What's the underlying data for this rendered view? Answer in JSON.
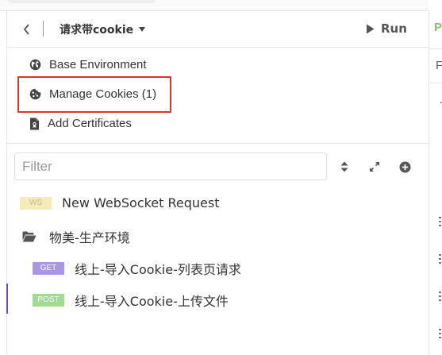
{
  "header": {
    "workspace_title": "请求带cookie",
    "run_label": "Run"
  },
  "menu": {
    "items": [
      {
        "label": "Base Environment",
        "icon": "globe-icon"
      },
      {
        "label": "Manage Cookies (1)",
        "icon": "cookie-icon"
      },
      {
        "label": "Add Certificates",
        "icon": "certificate-icon"
      }
    ],
    "highlight_color": "#d9372a"
  },
  "filter": {
    "placeholder": "Filter"
  },
  "tree": {
    "ws_request": {
      "tag": "WS",
      "label": "New WebSocket Request"
    },
    "folder": {
      "label": "物美-生产环境"
    },
    "requests": [
      {
        "method": "GET",
        "label": "线上-导入Cookie-列表页请求"
      },
      {
        "method": "POST",
        "label": "线上-导入Cookie-上传文件"
      }
    ]
  },
  "right_panel": {
    "tab_initial": "P",
    "subtab_initial": "F"
  },
  "colors": {
    "get": "#a996e6",
    "post": "#9fdc92",
    "ws": "#f4ebb7",
    "accent": "#6a4ec2",
    "right_tab": "#86c270"
  }
}
